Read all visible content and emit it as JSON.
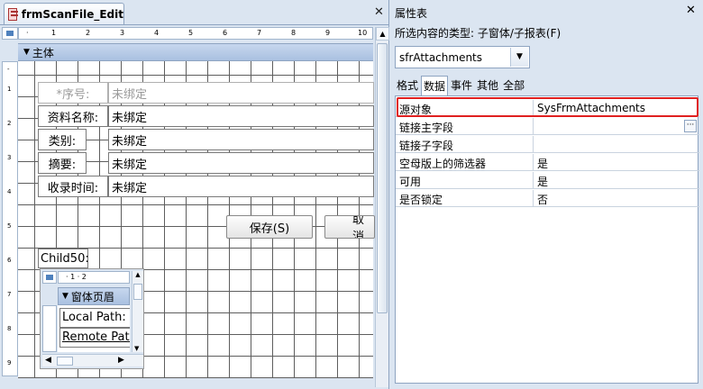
{
  "designer": {
    "tab_title": "frmScanFile_Edit",
    "close_glyph": "✕",
    "section_label": "主体",
    "ruler_numbers": [
      "1",
      "2",
      "3",
      "4",
      "5",
      "6",
      "7",
      "8",
      "9",
      "10"
    ],
    "vruler_numbers": [
      "1",
      "2",
      "3",
      "4",
      "5",
      "6",
      "7",
      "8",
      "9"
    ],
    "fields": [
      {
        "label": "*序号:",
        "value": "未绑定",
        "dim": true
      },
      {
        "label": "资料名称:",
        "value": "未绑定",
        "dim": false
      },
      {
        "label": "类别:",
        "value": "未绑定",
        "dim": false
      },
      {
        "label": "摘要:",
        "value": "未绑定",
        "dim": false
      },
      {
        "label": "收录时间:",
        "value": "未绑定",
        "dim": false
      }
    ],
    "save_button": "保存(S)",
    "cancel_button": "取消",
    "child_label": "Child50:",
    "subform": {
      "ruler": "· 1 · 2",
      "section": "窗体页眉",
      "fields": [
        "Local Path:",
        "Remote Path"
      ]
    }
  },
  "props": {
    "title": "属性表",
    "close_glyph": "✕",
    "selection_type": "所选内容的类型: 子窗体/子报表(F)",
    "object_name": "sfrAttachments",
    "tabs": [
      "格式",
      "数据",
      "事件",
      "其他",
      "全部"
    ],
    "active_tab": "数据",
    "rows": [
      {
        "key": "源对象",
        "value": "SysFrmAttachments"
      },
      {
        "key": "链接主字段",
        "value": ""
      },
      {
        "key": "链接子字段",
        "value": ""
      },
      {
        "key": "空母版上的筛选器",
        "value": "是"
      },
      {
        "key": "可用",
        "value": "是"
      },
      {
        "key": "是否锁定",
        "value": "否"
      }
    ],
    "highlight_color": "#e02020"
  }
}
